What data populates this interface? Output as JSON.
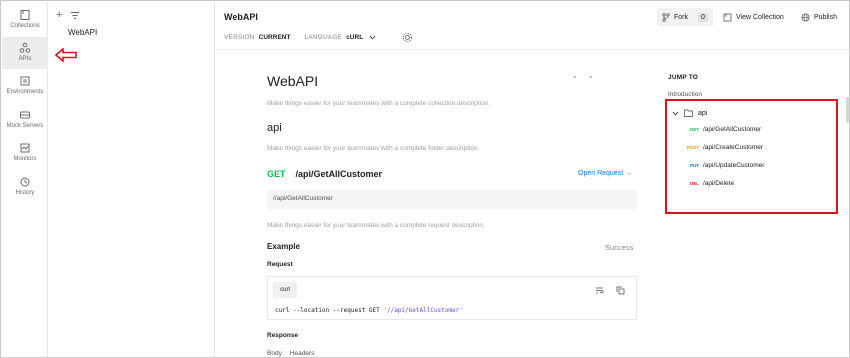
{
  "rail": {
    "items": [
      {
        "label": "Collections",
        "icon": "collections-icon"
      },
      {
        "label": "APIs",
        "icon": "apis-icon",
        "active": true
      },
      {
        "label": "Environments",
        "icon": "environments-icon"
      },
      {
        "label": "Mock Servers",
        "icon": "mock-servers-icon"
      },
      {
        "label": "Monitors",
        "icon": "monitors-icon"
      },
      {
        "label": "History",
        "icon": "history-icon"
      }
    ]
  },
  "sidebar": {
    "add_icon": "+",
    "filter_icon": "filter-icon",
    "api_name": "WebAPI"
  },
  "header": {
    "title": "WebAPI",
    "fork_label": "Fork",
    "fork_count": "0",
    "view_collection_label": "View Collection",
    "publish_label": "Publish",
    "version_key": "VERSION",
    "version_value": "CURRENT",
    "language_key": "LANGUAGE",
    "language_value": "cURL"
  },
  "doc": {
    "title": "WebAPI",
    "collection_desc": "Make things easier for your teammates with a complete collection description.",
    "folder_title": "api",
    "folder_desc": "Make things easier for your teammates with a complete folder description.",
    "request_method": "GET",
    "request_path": "/api/GetAllCustomer",
    "open_request_label": "Open Request →",
    "url": "//api/GetAllCustomer",
    "request_desc": "Make things easier for your teammates with a complete request description.",
    "example_label": "Example",
    "example_status": "Success",
    "request_label": "Request",
    "code_lang": "curl",
    "code_prefix": "curl --location --request GET ",
    "code_url": "'//api/GetAllCustomer'",
    "response_label": "Response",
    "response_tabs": [
      "Body",
      "Headers"
    ]
  },
  "toc": {
    "heading": "JUMP TO",
    "intro": "Introduction",
    "folder": "api",
    "requests": [
      {
        "method": "GET",
        "path": "/api/GetAllCustomer",
        "color": "#0cbb52"
      },
      {
        "method": "POST",
        "path": "/api/CreateCustomer",
        "color": "#e89418"
      },
      {
        "method": "PUT",
        "path": "/api/UpdateCustomer",
        "color": "#097bed"
      },
      {
        "method": "DEL",
        "path": "/api/Delete",
        "color": "#eb2013"
      }
    ]
  },
  "colors": {
    "annotation_red": "#d9141f",
    "get_green": "#0cbb52",
    "link_blue": "#097bed"
  }
}
